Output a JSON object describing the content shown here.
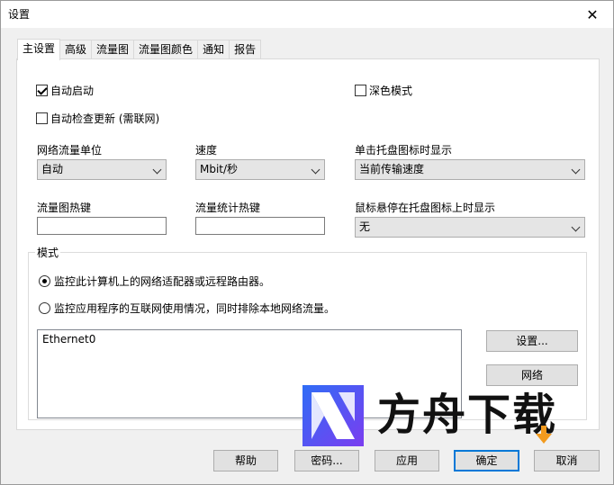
{
  "window": {
    "title": "设置",
    "close_glyph": "✕"
  },
  "tabs": [
    {
      "label": "主设置",
      "active": true
    },
    {
      "label": "高级"
    },
    {
      "label": "流量图"
    },
    {
      "label": "流量图颜色"
    },
    {
      "label": "通知"
    },
    {
      "label": "报告"
    }
  ],
  "main": {
    "autostart": {
      "label": "自动启动",
      "checked": true
    },
    "dark_mode": {
      "label": "深色模式",
      "checked": false
    },
    "auto_update": {
      "label": "自动检查更新 (需联网)",
      "checked": false
    },
    "traffic_unit": {
      "label": "网络流量单位",
      "value": "自动"
    },
    "speed": {
      "label": "速度",
      "value": "Mbit/秒"
    },
    "tray_click": {
      "label": "单击托盘图标时显示",
      "value": "当前传输速度"
    },
    "graph_hotkey": {
      "label": "流量图热键",
      "value": ""
    },
    "stats_hotkey": {
      "label": "流量统计热键",
      "value": ""
    },
    "tray_hover": {
      "label": "鼠标悬停在托盘图标上时显示",
      "value": "无"
    }
  },
  "mode": {
    "label": "模式",
    "option_adapters": {
      "label": "监控此计算机上的网络适配器或远程路由器。",
      "selected": true
    },
    "option_apps": {
      "label": "监控应用程序的互联网使用情况，同时排除本地网络流量。",
      "selected": false
    },
    "adapters": [
      "Ethernet0"
    ],
    "setup_button": "设置...",
    "network_button": "网络"
  },
  "footer": {
    "help": "帮助",
    "password": "密码...",
    "apply": "应用",
    "ok": "确定",
    "cancel": "取消"
  },
  "watermark": {
    "text": "方舟下载",
    "colors": {
      "blue": "#2f6df6",
      "purple": "#7b3df0",
      "orange": "#f29a1e"
    }
  }
}
